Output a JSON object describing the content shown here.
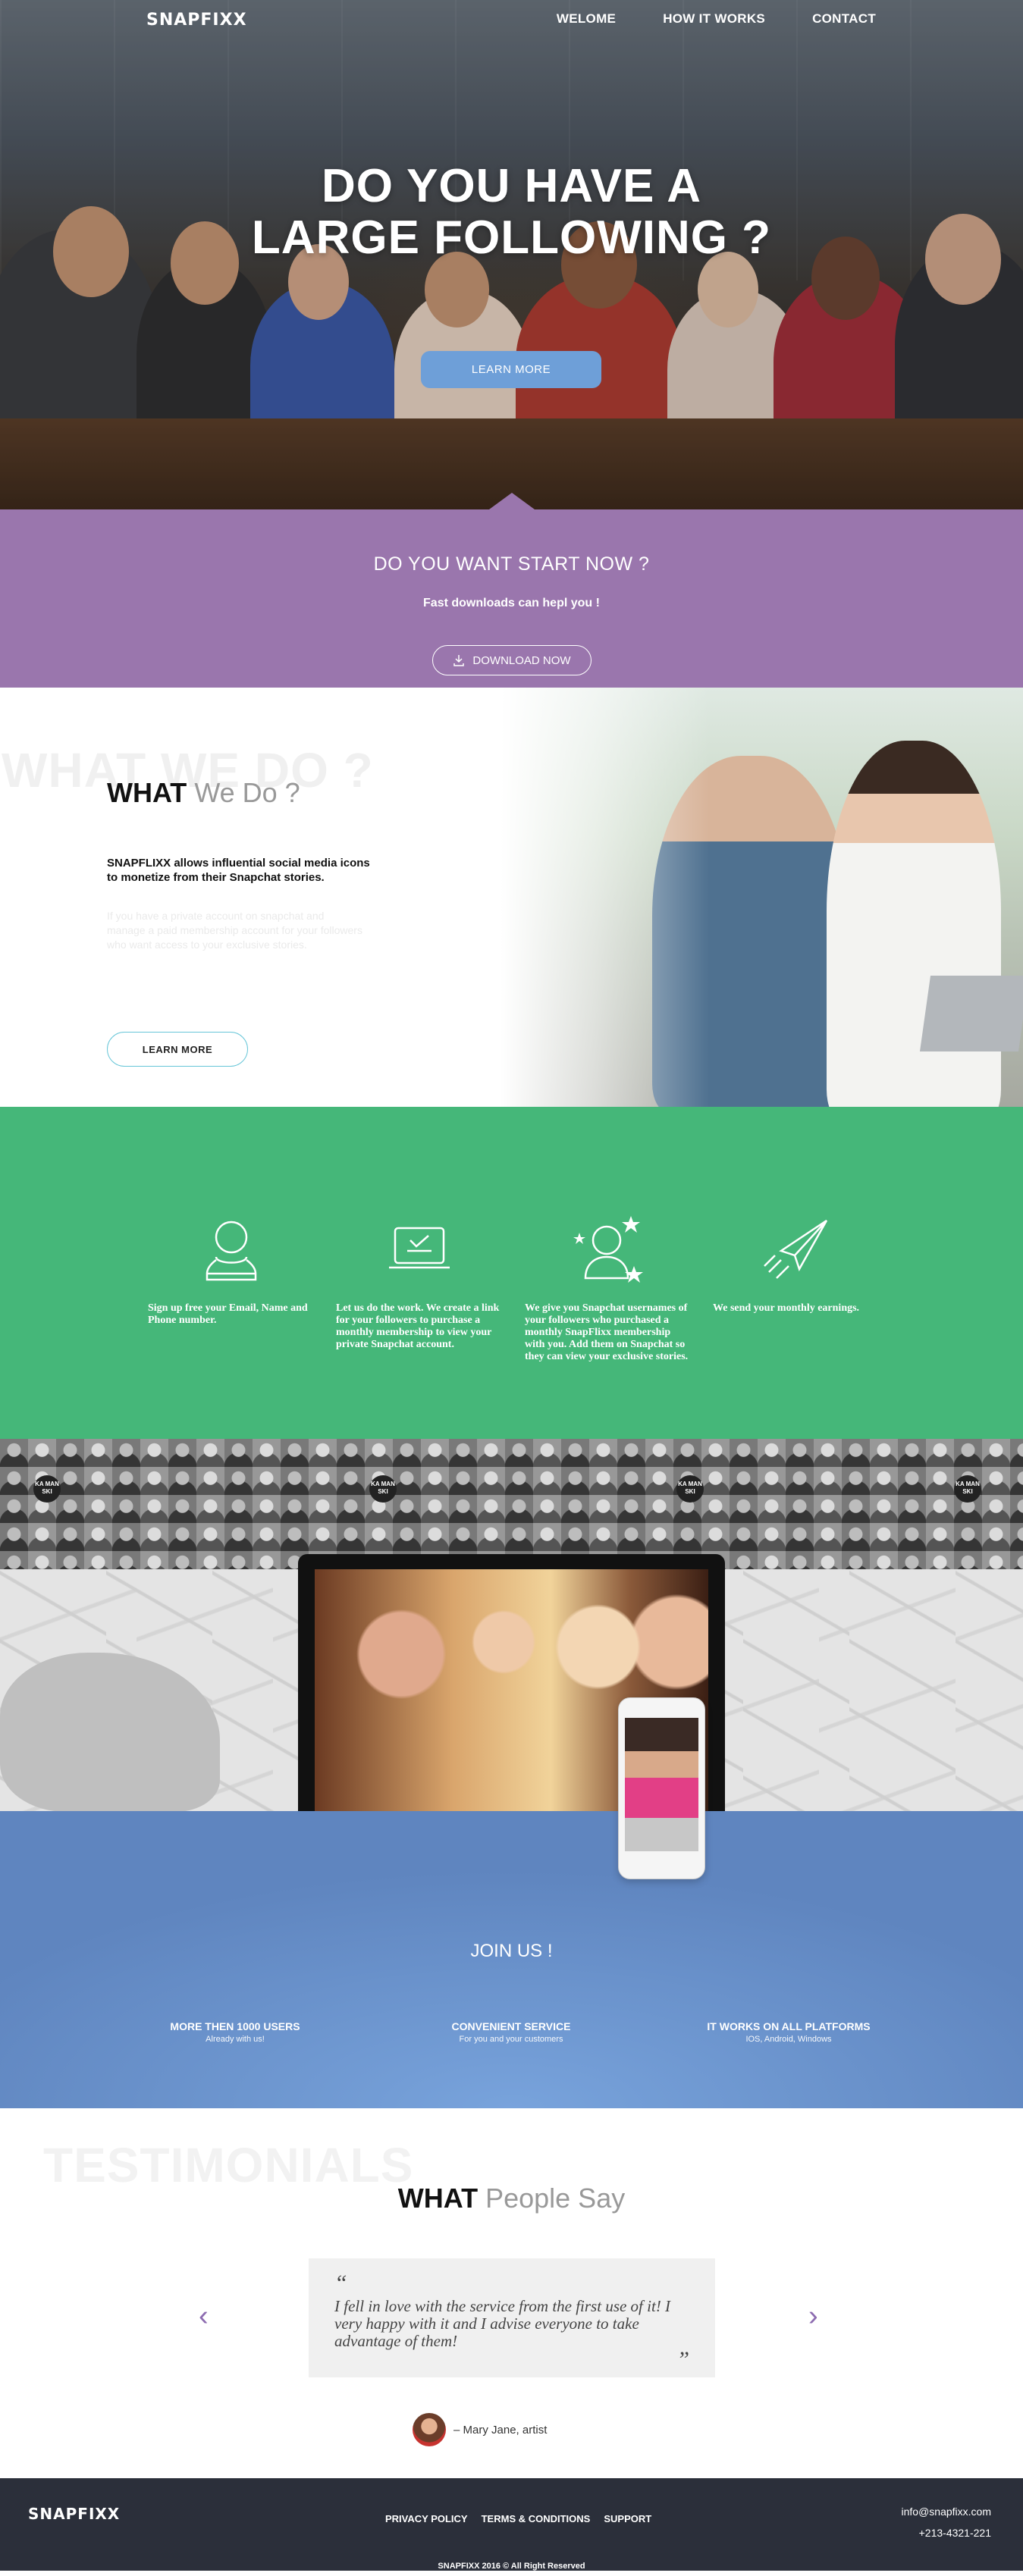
{
  "nav": {
    "logo": "SNAPFIXX",
    "links": [
      "WELOME",
      "HOW IT WORKS",
      "CONTACT"
    ]
  },
  "hero": {
    "title_line1": "DO YOU HAVE A",
    "title_line2": "LARGE FOLLOWING ?",
    "button": "LEARN MORE"
  },
  "cta": {
    "heading": "DO YOU WANT START NOW ?",
    "sub": "Fast downloads can hepl you !",
    "button": "DOWNLOAD NOW"
  },
  "what_we_do": {
    "ghost": "WHAT WE DO ?",
    "title_bold": "WHAT",
    "title_light": "We Do ?",
    "lead": "SNAPFLIXX allows influential social media icons to monetize from their Snapchat stories.",
    "faint": "If you have a private account on snapchat and manage a paid membership account for your followers who want access to your exclusive stories.",
    "button": "LEARN MORE"
  },
  "steps": [
    {
      "icon": "user-icon",
      "text": "Sign up free your Email, Name and Phone number."
    },
    {
      "icon": "laptop-check-icon",
      "text": "Let us do the work. We create a link for your followers to purchase a monthly membership to view your private Snapchat account."
    },
    {
      "icon": "user-stars-icon",
      "text": "We give you Snapchat usernames of your followers who purchased a monthly SnapFlixx membership with you. Add them on Snapchat so they can view your exclusive stories."
    },
    {
      "icon": "paper-plane-icon",
      "text": "We send your monthly earnings."
    }
  ],
  "badges": [
    "KA MAN SKI",
    "KA MAN SKI",
    "KA MAN SKI",
    "KA MAN SKI"
  ],
  "join": {
    "heading": "JOIN US !",
    "features": [
      {
        "title": "MORE THEN 1000 USERS",
        "sub": "Already with us!"
      },
      {
        "title": "CONVENIENT SERVICE",
        "sub": "For you and your customers"
      },
      {
        "title": "IT WORKS ON ALL PLATFORMS",
        "sub": "IOS, Android, Windows"
      }
    ]
  },
  "testimonials": {
    "ghost": "TESTIMONIALS",
    "title_bold": "WHAT",
    "title_light": "People Say",
    "open_quote": "“",
    "close_quote": "”",
    "quote": "I fell in love with the service from the first use of it! I very happy with it and I advise everyone to take advantage of them!",
    "author": "– Mary Jane, artist",
    "prev": "‹",
    "next": "›"
  },
  "footer": {
    "logo": "SNAPFIXX",
    "links": [
      "PRIVACY POLICY",
      "TERMS & CONDITIONS",
      "SUPPORT"
    ],
    "email": "info@snapfixx.com",
    "phone": "+213-4321-221",
    "copyright": "SNAPFIXX 2016 © All Right Reserved"
  },
  "colors": {
    "purple": "#9a76ad",
    "green": "#45b779",
    "blue": "#6e97d0",
    "footer": "#2b2f3a",
    "hero_button": "#6e9fd8"
  }
}
